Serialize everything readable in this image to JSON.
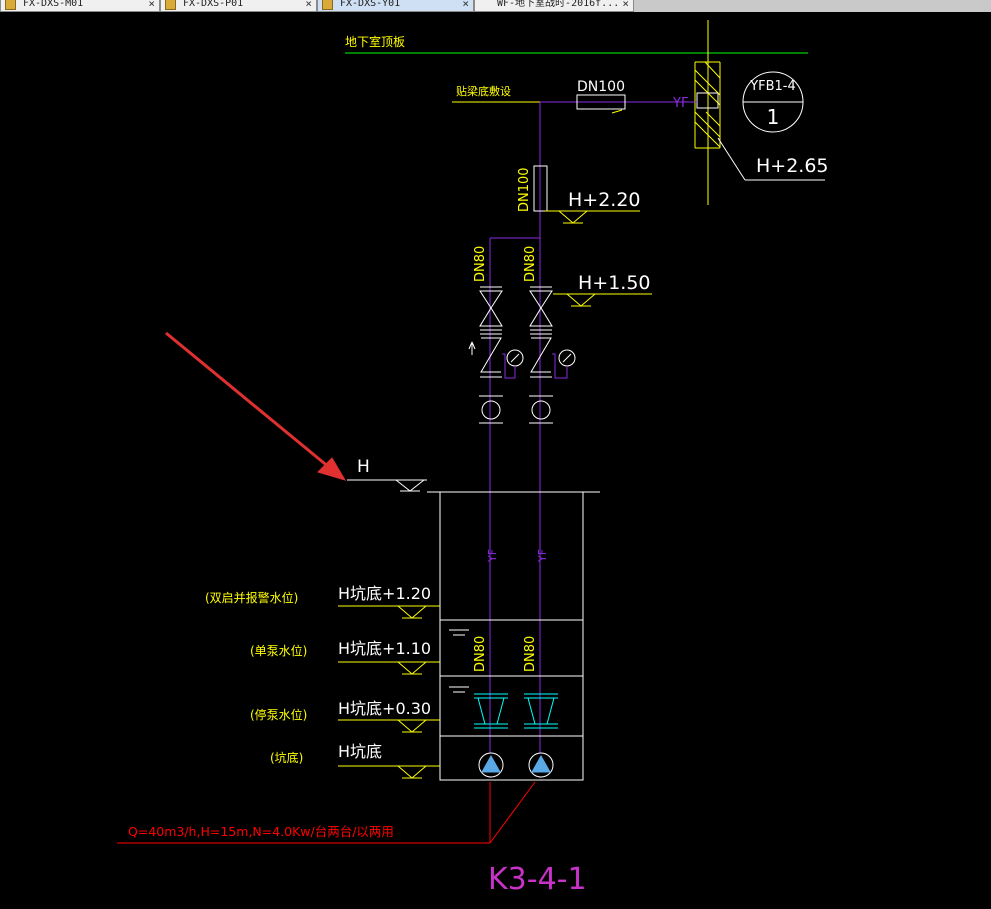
{
  "tabs": [
    {
      "label": "FX-DXS-M01",
      "active": false
    },
    {
      "label": "FX-DXS-P01",
      "active": false
    },
    {
      "label": "FX-DXS-Y01",
      "active": true
    },
    {
      "label": "WF-地下室战时-2016f...",
      "active": false
    }
  ],
  "tab_close_glyph": "×",
  "colors": {
    "yellow": "#ffff00",
    "green": "#00ff00",
    "purple": "#8a2be2",
    "white": "#ffffff",
    "cyan": "#00ffff",
    "red": "#ff0000",
    "magenta": "#c832c8",
    "blue_pump": "#5aa9e6"
  },
  "drawing": {
    "basement_roof_label": "地下室顶板",
    "beam_bottom_label": "贴梁底敷设",
    "dn100_horizontal": "DN100",
    "yf_horizontal": "YF",
    "yfb_tag_top": "YFB1-4",
    "yfb_tag_bottom": "1",
    "elev_265": "H+2.65",
    "dn100_vertical": "DN100",
    "elev_220": "H+2.20",
    "dn80_left_upper": "DN80",
    "dn80_right_upper": "DN80",
    "elev_150": "H+1.50",
    "floor_label": "H",
    "yf_left": "YF",
    "yf_right": "YF",
    "level_desc_1": "(双启并报警水位)",
    "level_val_1": "H坑底+1.20",
    "level_desc_2": "(单泵水位)",
    "level_val_2": "H坑底+1.10",
    "level_desc_3": "(停泵水位)",
    "level_val_3": "H坑底+0.30",
    "level_desc_4": "(坑底)",
    "level_val_4": "H坑底",
    "dn80_left_lower": "DN80",
    "dn80_right_lower": "DN80",
    "pump_spec": "Q=40m3/h,H=15m,N=4.0Kw/台两台/以两用",
    "drawing_id": "K3-4-1"
  }
}
